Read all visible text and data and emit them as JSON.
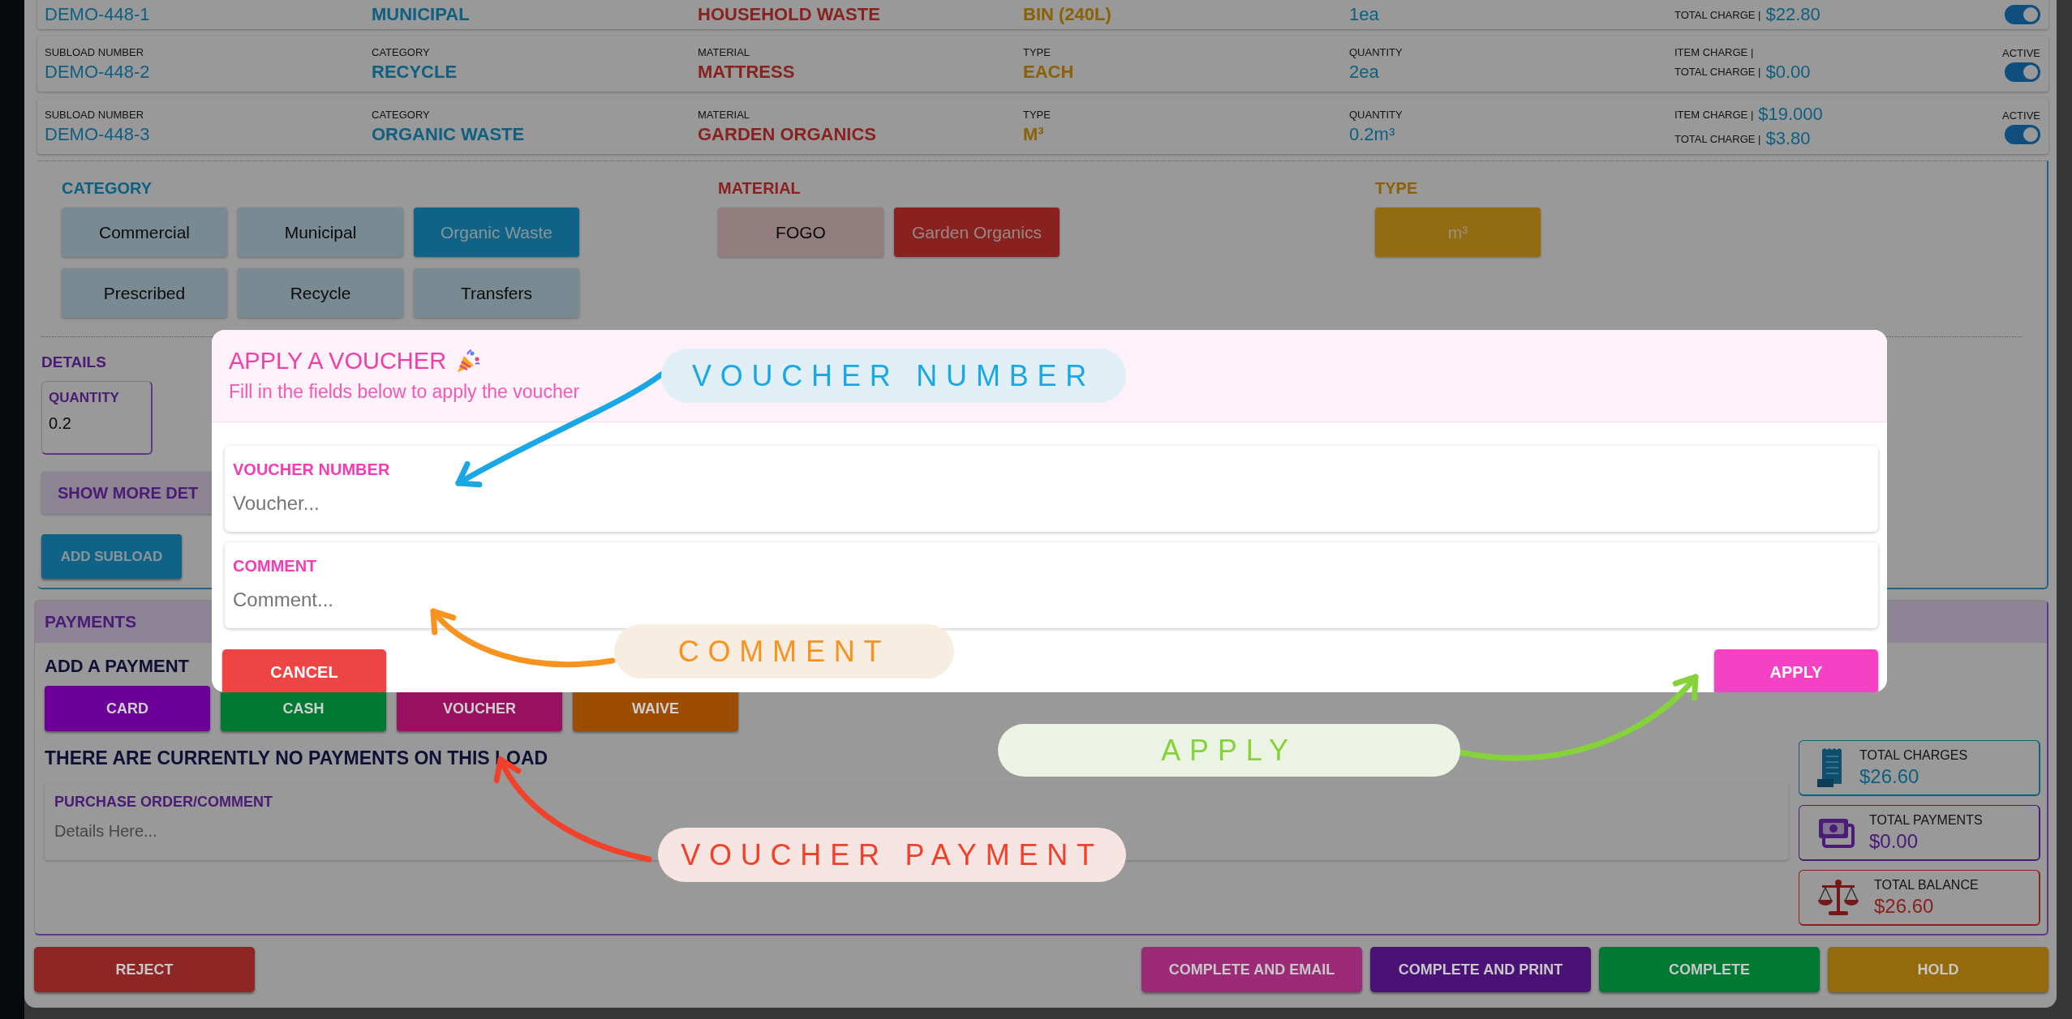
{
  "subloads": [
    {
      "fields": [
        {
          "kind": "number",
          "value": "DEMO-448-1"
        },
        {
          "kind": "category",
          "value": "MUNICIPAL"
        },
        {
          "kind": "material",
          "value": "HOUSEHOLD WASTE"
        },
        {
          "kind": "type",
          "value": "BIN (240L)"
        },
        {
          "kind": "quantity",
          "value": "1ea"
        }
      ],
      "total_charge": {
        "label": "TOTAL CHARGE |",
        "value": "$22.80"
      },
      "active": true
    },
    {
      "fields": [
        {
          "kind": "number",
          "label": "SUBLOAD NUMBER",
          "value": "DEMO-448-2"
        },
        {
          "kind": "category",
          "label": "CATEGORY",
          "value": "RECYCLE"
        },
        {
          "kind": "material",
          "label": "MATERIAL",
          "value": "MATTRESS"
        },
        {
          "kind": "type",
          "label": "TYPE",
          "value": "EACH"
        },
        {
          "kind": "quantity",
          "label": "QUANTITY",
          "value": "2ea"
        }
      ],
      "item_charge": {
        "label": "ITEM CHARGE |"
      },
      "total_charge": {
        "label": "TOTAL CHARGE |",
        "value": "$0.00"
      },
      "active_label": "ACTIVE",
      "active": true
    },
    {
      "fields": [
        {
          "kind": "number",
          "label": "SUBLOAD NUMBER",
          "value": "DEMO-448-3"
        },
        {
          "kind": "category",
          "label": "CATEGORY",
          "value": "ORGANIC WASTE"
        },
        {
          "kind": "material",
          "label": "MATERIAL",
          "value": "GARDEN ORGANICS"
        },
        {
          "kind": "type",
          "label": "TYPE",
          "value": "M³"
        },
        {
          "kind": "quantity",
          "label": "QUANTITY",
          "value": "0.2m³"
        }
      ],
      "item_charge": {
        "label": "ITEM CHARGE |",
        "value": "$19.000"
      },
      "total_charge": {
        "label": "TOTAL CHARGE |",
        "value": "$3.80"
      },
      "active_label": "ACTIVE",
      "active": true
    }
  ],
  "category": {
    "title": "CATEGORY",
    "options": [
      {
        "label": "Commercial",
        "selected": false
      },
      {
        "label": "Municipal",
        "selected": false
      },
      {
        "label": "Organic Waste",
        "selected": true
      },
      {
        "label": "Prescribed",
        "selected": false
      },
      {
        "label": "Recycle",
        "selected": false
      },
      {
        "label": "Transfers",
        "selected": false
      }
    ]
  },
  "material": {
    "title": "MATERIAL",
    "options": [
      {
        "label": "FOGO",
        "selected": false
      },
      {
        "label": "Garden Organics",
        "selected": true
      }
    ]
  },
  "type": {
    "title": "TYPE",
    "options": [
      {
        "label": "m³",
        "selected": true
      }
    ]
  },
  "details": {
    "title": "DETAILS",
    "quantity_label": "QUANTITY",
    "quantity_value": "0.2",
    "show_more": "SHOW MORE DET",
    "add_subload": "ADD SUBLOAD"
  },
  "payments": {
    "title": "PAYMENTS",
    "add_label": "ADD A PAYMENT",
    "methods": [
      {
        "label": "CARD",
        "color": "#6e009a"
      },
      {
        "label": "CASH",
        "color": "#007a33"
      },
      {
        "label": "VOUCHER",
        "color": "#9a1060"
      },
      {
        "label": "WAIVE",
        "color": "#9c4d00"
      }
    ],
    "empty_message": "THERE ARE CURRENTLY NO PAYMENTS ON THIS LOAD",
    "purchase_order": {
      "label": "PURCHASE ORDER/COMMENT",
      "placeholder": "Details Here..."
    },
    "totals": [
      {
        "kind": "charges",
        "label": "TOTAL CHARGES",
        "value": "$26.60"
      },
      {
        "kind": "payments",
        "label": "TOTAL PAYMENTS",
        "value": "$0.00"
      },
      {
        "kind": "balance",
        "label": "TOTAL BALANCE",
        "value": "$26.60"
      }
    ]
  },
  "actions": [
    {
      "label": "REJECT",
      "color": "#8e2626"
    },
    {
      "label": "COMPLETE AND EMAIL",
      "color": "#9b2a77"
    },
    {
      "label": "COMPLETE AND PRINT",
      "color": "#4a1277"
    },
    {
      "label": "COMPLETE",
      "color": "#007a33"
    },
    {
      "label": "HOLD",
      "color": "#956a0c"
    }
  ],
  "modal": {
    "title": "APPLY A VOUCHER",
    "subtitle": "Fill in the fields below to apply the voucher",
    "fields": [
      {
        "label": "VOUCHER NUMBER",
        "placeholder": "Voucher..."
      },
      {
        "label": "COMMENT",
        "placeholder": "Comment..."
      }
    ],
    "cancel": "CANCEL",
    "apply": "APPLY"
  },
  "annotations": [
    {
      "text": "VOUCHER NUMBER",
      "color": "#1aa7e6"
    },
    {
      "text": "COMMENT",
      "color": "#f7931e"
    },
    {
      "text": "APPLY",
      "color": "#86d23a"
    },
    {
      "text": "VOUCHER PAYMENT",
      "color": "#f2412b"
    }
  ]
}
